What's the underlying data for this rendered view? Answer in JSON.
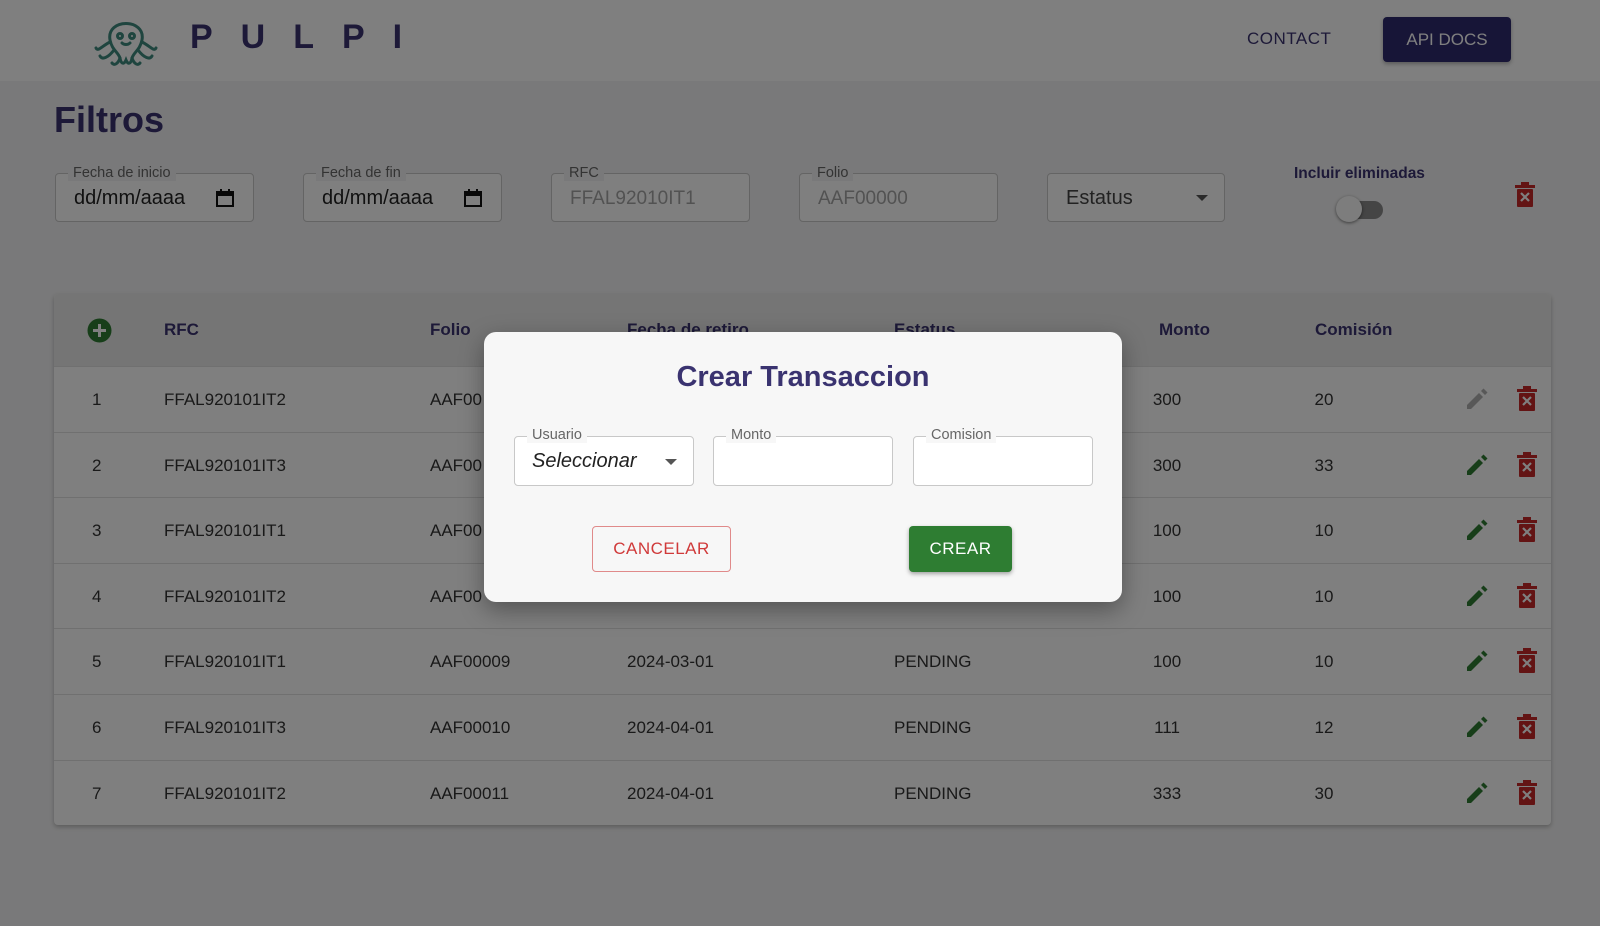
{
  "header": {
    "logo_text": "PULPI",
    "nav_contact": "CONTACT",
    "nav_api_docs": "API DOCS"
  },
  "filters": {
    "title": "Filtros",
    "start_date": {
      "label": "Fecha de inicio",
      "value": "dd/mm/aaaa"
    },
    "end_date": {
      "label": "Fecha de fin",
      "value": "dd/mm/aaaa"
    },
    "rfc": {
      "label": "RFC",
      "placeholder": "FFAL92010IT1"
    },
    "folio": {
      "label": "Folio",
      "placeholder": "AAF00000"
    },
    "status": {
      "value": "Estatus"
    },
    "include_deleted": {
      "label": "Incluir eliminadas",
      "checked": false
    }
  },
  "table": {
    "headers": [
      "RFC",
      "Folio",
      "Fecha de retiro",
      "Estatus",
      "Monto",
      "Comisión"
    ],
    "rows": [
      {
        "n": "1",
        "rfc": "FFAL920101IT2",
        "folio": "AAF00",
        "fecha": "",
        "estatus": "",
        "monto": "300",
        "comision": "20",
        "edit_enabled": false
      },
      {
        "n": "2",
        "rfc": "FFAL920101IT3",
        "folio": "AAF00",
        "fecha": "",
        "estatus": "",
        "monto": "300",
        "comision": "33",
        "edit_enabled": true
      },
      {
        "n": "3",
        "rfc": "FFAL920101IT1",
        "folio": "AAF00",
        "fecha": "",
        "estatus": "",
        "monto": "100",
        "comision": "10",
        "edit_enabled": true
      },
      {
        "n": "4",
        "rfc": "FFAL920101IT2",
        "folio": "AAF00",
        "fecha": "",
        "estatus": "",
        "monto": "100",
        "comision": "10",
        "edit_enabled": true
      },
      {
        "n": "5",
        "rfc": "FFAL920101IT1",
        "folio": "AAF00009",
        "fecha": "2024-03-01",
        "estatus": "PENDING",
        "monto": "100",
        "comision": "10",
        "edit_enabled": true
      },
      {
        "n": "6",
        "rfc": "FFAL920101IT3",
        "folio": "AAF00010",
        "fecha": "2024-04-01",
        "estatus": "PENDING",
        "monto": "111",
        "comision": "12",
        "edit_enabled": true
      },
      {
        "n": "7",
        "rfc": "FFAL920101IT2",
        "folio": "AAF00011",
        "fecha": "2024-04-01",
        "estatus": "PENDING",
        "monto": "333",
        "comision": "30",
        "edit_enabled": true
      }
    ]
  },
  "modal": {
    "title": "Crear Transaccion",
    "usuario": {
      "label": "Usuario",
      "value": "Seleccionar"
    },
    "monto": {
      "label": "Monto",
      "value": ""
    },
    "comision": {
      "label": "Comision",
      "value": ""
    },
    "cancel_label": "CANCELAR",
    "create_label": "CREAR"
  },
  "colors": {
    "brand": "#3a3370",
    "api_button": "#2f2a6e",
    "create_button": "#2e7d32",
    "cancel_text": "#d03a3a",
    "delete_icon": "#c62828",
    "edit_icon": "#2e7d32"
  }
}
